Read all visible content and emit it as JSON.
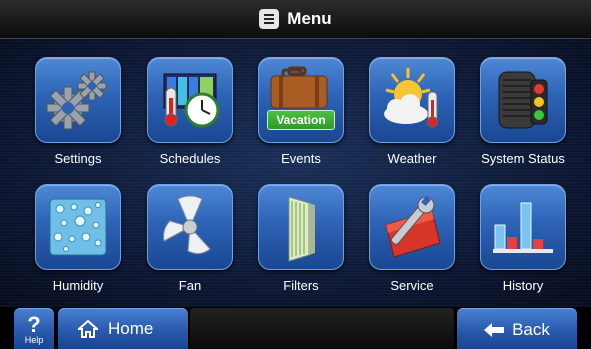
{
  "header": {
    "title": "Menu",
    "icon": "menu-list-icon"
  },
  "tiles": [
    {
      "label": "Settings",
      "icon": "gears-icon"
    },
    {
      "label": "Schedules",
      "icon": "thermometer-clock-icon"
    },
    {
      "label": "Events",
      "icon": "suitcase-icon",
      "badge": "Vacation"
    },
    {
      "label": "Weather",
      "icon": "sun-cloud-icon"
    },
    {
      "label": "System Status",
      "icon": "ac-unit-status-icon"
    },
    {
      "label": "Humidity",
      "icon": "droplets-icon"
    },
    {
      "label": "Fan",
      "icon": "fan-icon"
    },
    {
      "label": "Filters",
      "icon": "filter-icon"
    },
    {
      "label": "Service",
      "icon": "wrench-toolbox-icon"
    },
    {
      "label": "History",
      "icon": "bar-chart-icon"
    }
  ],
  "footer": {
    "help_symbol": "?",
    "help_label": "Help",
    "home_label": "Home",
    "back_label": "Back"
  },
  "colors": {
    "tile_blue": "#2d63b5",
    "badge_green": "#2e9a2a",
    "background": "#0b1530"
  }
}
